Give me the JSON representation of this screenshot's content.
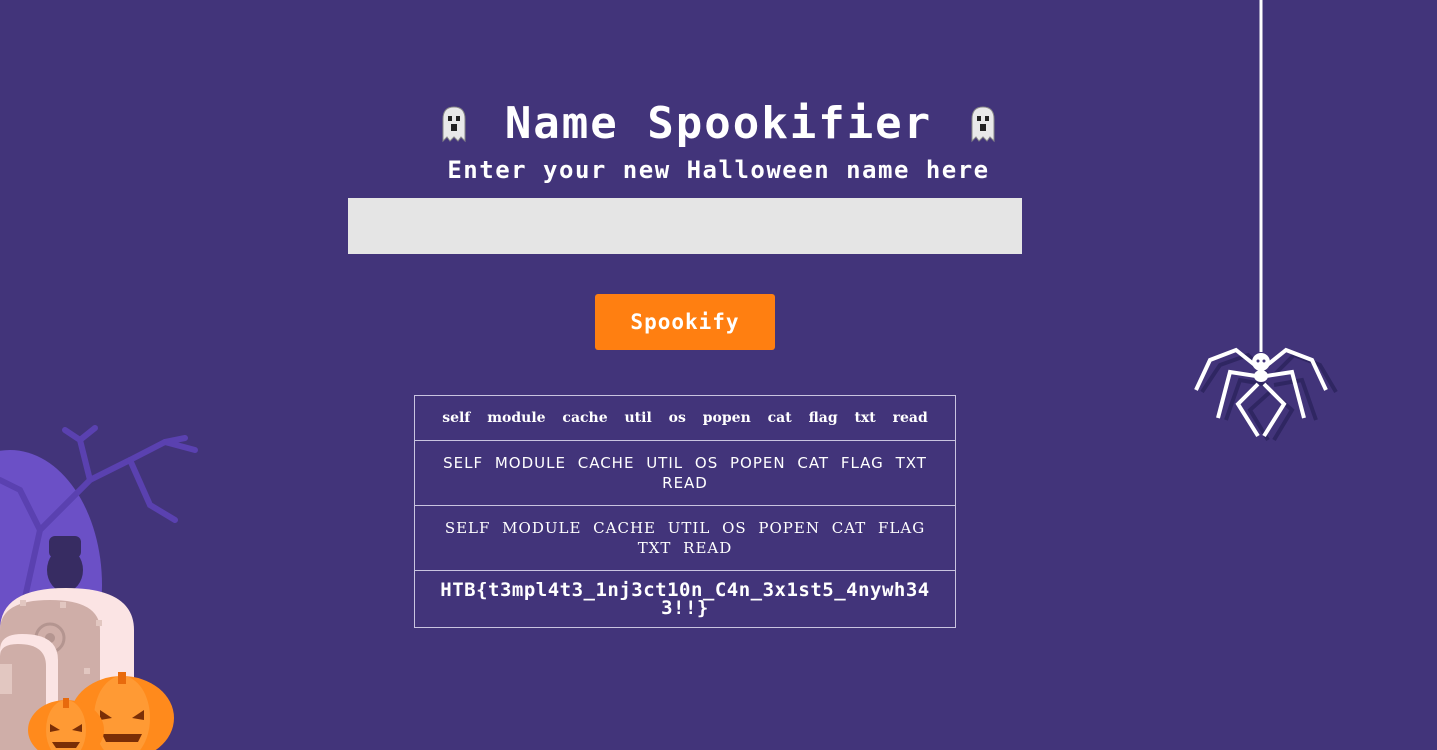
{
  "header": {
    "title": "Name Spookifier",
    "subtitle": "Enter your new Halloween name here"
  },
  "form": {
    "name_value": "",
    "name_placeholder": "",
    "submit_label": "Spookify"
  },
  "results": {
    "rows": [
      "self module cache util os popen cat flag txt read",
      "SELF MODULE CACHE UTIL OS POPEN CAT FLAG TXT READ",
      "SELF MODULE CACHE UTIL OS POPEN CAT FLAG TXT READ",
      "HTB{t3mpl4t3_1nj3ct10n_C4n_3x1st5_4nywh343!!}"
    ]
  },
  "colors": {
    "background": "#42347a",
    "accent": "#ff7f11",
    "input_bg": "#e5e5e5"
  },
  "icons": {
    "left": "ghost-icon",
    "right": "ghost-icon",
    "decoration_right": "spider-icon",
    "decoration_left": "graveyard-pumpkins"
  }
}
